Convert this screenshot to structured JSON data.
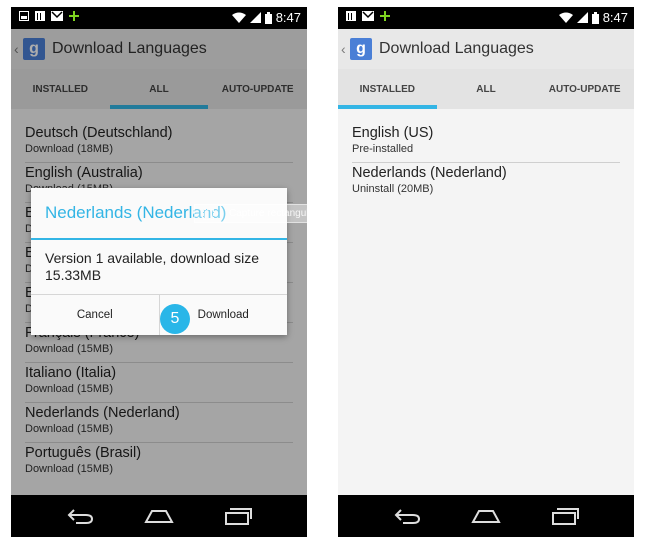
{
  "colors": {
    "accent": "#33b5e5",
    "status_bar": "#000000",
    "action_bar": "#e8e8e8",
    "nav_bar": "#000000"
  },
  "status_bar": {
    "time": "8:47",
    "left_icons": [
      "screenshot-icon",
      "calendar-icon",
      "gmail-icon",
      "plus-icon"
    ],
    "right_icons": [
      "wifi-icon",
      "signal-icon",
      "battery-icon"
    ]
  },
  "left_screen": {
    "app_title": "Download Languages",
    "tabs": [
      {
        "label": "INSTALLED"
      },
      {
        "label": "ALL"
      },
      {
        "label": "AUTO-UPDATE"
      }
    ],
    "active_tab": "ALL",
    "languages": [
      {
        "name": "Deutsch (Deutschland)",
        "sub": "Download (18MB)"
      },
      {
        "name": "English (Australia)",
        "sub": "Download (15MB)"
      },
      {
        "name": "E",
        "sub": "D"
      },
      {
        "name": "E",
        "sub": "D"
      },
      {
        "name": "E",
        "sub": "D"
      },
      {
        "name": "Français (France)",
        "sub": "Download (15MB)"
      },
      {
        "name": "Italiano (Italia)",
        "sub": "Download (15MB)"
      },
      {
        "name": "Nederlands (Nederland)",
        "sub": "Download (15MB)"
      },
      {
        "name": "Português (Brasil)",
        "sub": "Download (15MB)"
      }
    ],
    "dialog": {
      "title": "Nederlands (Nederland)",
      "message": "Version 1 available, download size 15.33MB",
      "cancel_label": "Cancel",
      "download_label": "Download",
      "step_number": "5"
    },
    "ghost_label": "Capture rectangulaire"
  },
  "right_screen": {
    "app_title": "Download Languages",
    "tabs": [
      {
        "label": "INSTALLED"
      },
      {
        "label": "ALL"
      },
      {
        "label": "AUTO-UPDATE"
      }
    ],
    "active_tab": "INSTALLED",
    "languages": [
      {
        "name": "English (US)",
        "sub": "Pre-installed"
      },
      {
        "name": "Nederlands (Nederland)",
        "sub": "Uninstall (20MB)"
      }
    ]
  },
  "nav_icons": [
    "back-icon",
    "home-icon",
    "recents-icon"
  ]
}
